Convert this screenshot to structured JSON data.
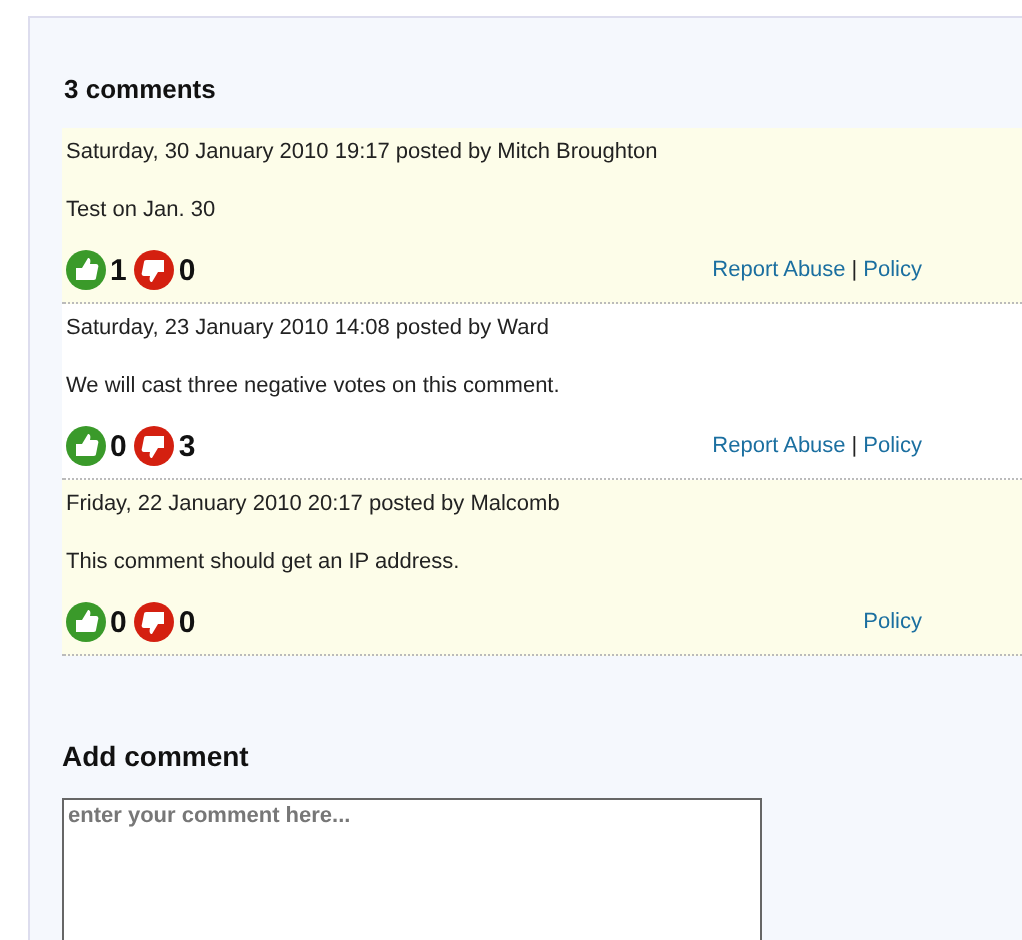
{
  "comments_heading": "3 comments",
  "comments": [
    {
      "meta": "Saturday, 30 January 2010 19:17 posted by Mitch Broughton",
      "text": "Test on Jan. 30",
      "up": "1",
      "down": "0",
      "report_link": "Report Abuse",
      "separator": "|",
      "policy_link": "Policy"
    },
    {
      "meta": "Saturday, 23 January 2010 14:08 posted by Ward",
      "text": "We will cast three negative votes on this comment.",
      "up": "0",
      "down": "3",
      "report_link": "Report Abuse",
      "separator": "|",
      "policy_link": "Policy"
    },
    {
      "meta": "Friday, 22 January 2010 20:17 posted by Malcomb",
      "text": "This comment should get an IP address.",
      "up": "0",
      "down": "0",
      "policy_link": "Policy"
    }
  ],
  "add_heading": "Add comment",
  "comment_field": {
    "placeholder": "enter your comment here..."
  }
}
